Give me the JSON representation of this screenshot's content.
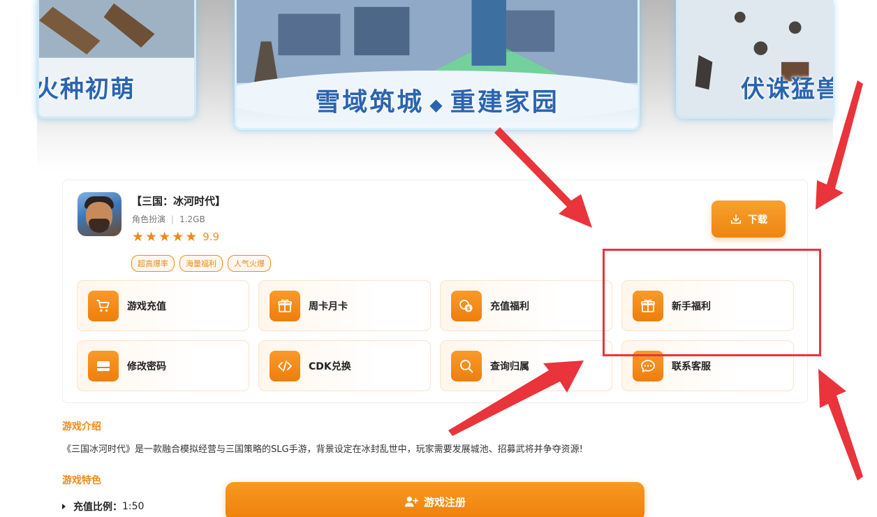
{
  "banner": {
    "slides": [
      {
        "caption": "火种初萌"
      },
      {
        "caption_part1": "雪域筑城",
        "caption_separator": "◆",
        "caption_part2": "重建家园"
      },
      {
        "caption": "伏诛猛兽"
      }
    ]
  },
  "app": {
    "title": "【三国：冰河时代】",
    "genre": "角色扮演",
    "meta_separator": "|",
    "size": "1.2GB",
    "rating": "9.9",
    "stars": 5,
    "tags": [
      "超高爆率",
      "海量福利",
      "人气火爆"
    ],
    "download_label": "下载"
  },
  "services": [
    {
      "label": "游戏充值",
      "icon": "cart-icon"
    },
    {
      "label": "周卡月卡",
      "icon": "gift-icon"
    },
    {
      "label": "充值福利",
      "icon": "coins-icon"
    },
    {
      "label": "新手福利",
      "icon": "gift-icon"
    },
    {
      "label": "修改密码",
      "icon": "card-icon"
    },
    {
      "label": "CDK兑换",
      "icon": "code-icon"
    },
    {
      "label": "查询归属",
      "icon": "search-icon"
    },
    {
      "label": "联系客服",
      "icon": "chat-icon"
    }
  ],
  "intro": {
    "title": "游戏介绍",
    "text": "《三国冰河时代》是一款融合模拟经营与三国策略的SLG手游，背景设定在冰封乱世中，玩家需要发展城池、招募武将并争夺资源!"
  },
  "features": {
    "title": "游戏特色",
    "items": [
      {
        "label": "充值比例：",
        "value": "1:50"
      }
    ]
  },
  "register_label": "游戏注册",
  "colors": {
    "accent": "#f08a1a",
    "annotation": "#e8343a"
  }
}
